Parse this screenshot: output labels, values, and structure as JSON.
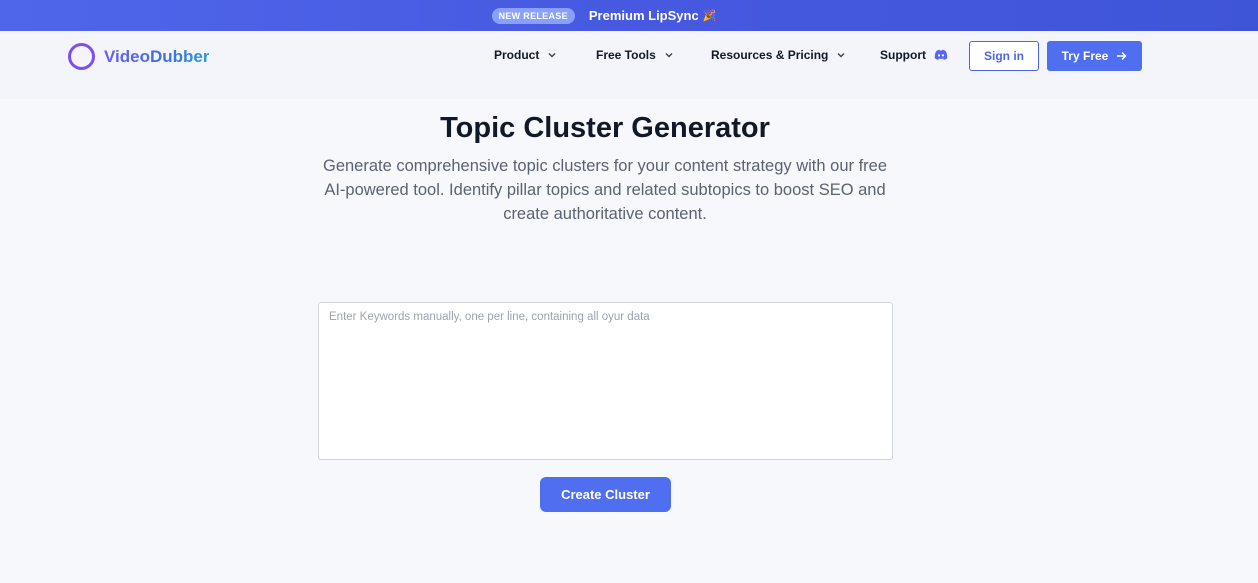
{
  "announcement": {
    "badge": "NEW RELEASE",
    "text": "Premium LipSync",
    "emoji": "🎉"
  },
  "brand": {
    "name": "VideoDubber",
    "logo_icon": "ring-logo-icon"
  },
  "nav": {
    "product": "Product",
    "free_tools": "Free Tools",
    "resources_pricing": "Resources & Pricing",
    "support": "Support",
    "support_icon": "discord-icon",
    "sign_in": "Sign in",
    "try_free": "Try Free"
  },
  "hero": {
    "title": "Topic Cluster Generator",
    "subtitle": "Generate comprehensive topic clusters for your content strategy with our free AI-powered tool. Identify pillar topics and related subtopics to boost SEO and create authoritative content."
  },
  "form": {
    "keywords_placeholder": "Enter Keywords manually, one per line, containing all oyur data",
    "keywords_value": "",
    "submit_label": "Create Cluster"
  },
  "colors": {
    "accent": "#4f6ef0",
    "banner": "#4659e0",
    "logo_ring": "#7c4ff0",
    "page_bg": "#f7f8fb"
  }
}
